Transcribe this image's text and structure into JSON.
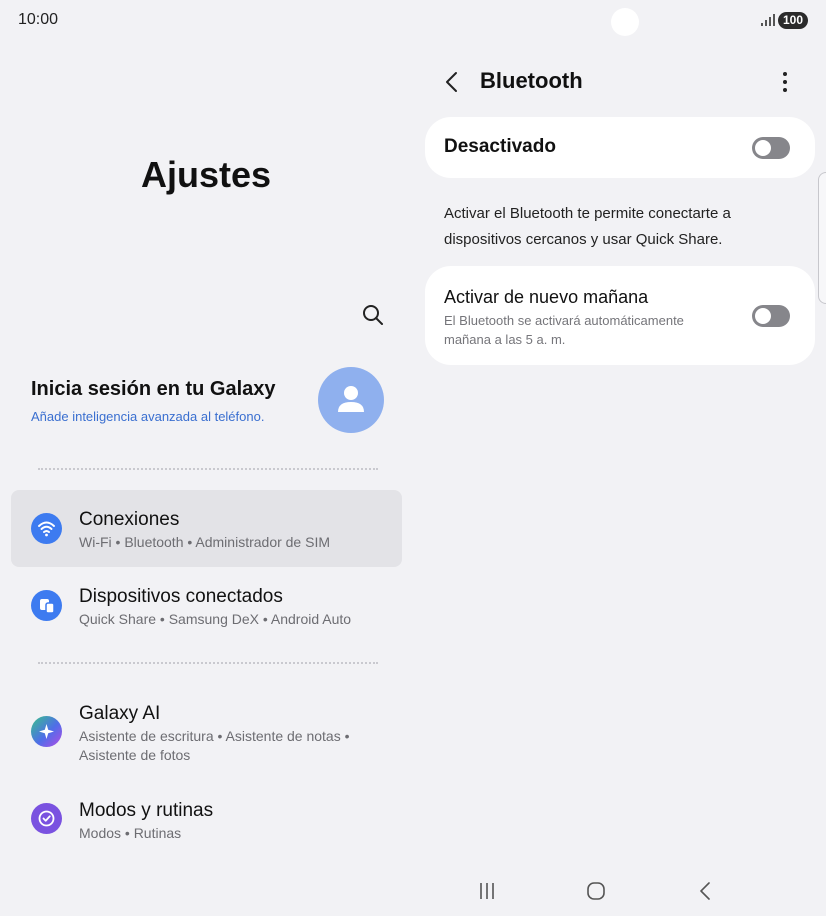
{
  "status_bar": {
    "time": "10:00",
    "battery": "100"
  },
  "settings": {
    "title": "Ajustes",
    "account": {
      "title": "Inicia sesión en tu Galaxy",
      "subtitle": "Añade inteligencia avanzada al teléfono."
    },
    "items": [
      {
        "title": "Conexiones",
        "subtitle": "Wi-Fi  •  Bluetooth  •  Administrador de SIM",
        "icon": "wifi-icon",
        "color": "#3d7bf0"
      },
      {
        "title": "Dispositivos conectados",
        "subtitle": "Quick Share  •  Samsung DeX  •  Android Auto",
        "icon": "devices-icon",
        "color": "#3d7bf0"
      },
      {
        "title": "Galaxy AI",
        "subtitle": "Asistente de escritura  •  Asistente de notas  •  Asistente de fotos",
        "icon": "sparkle-icon",
        "color": "#4f6ee8"
      },
      {
        "title": "Modos y rutinas",
        "subtitle": "Modos  •  Rutinas",
        "icon": "routine-icon",
        "color": "#7a52e0"
      }
    ]
  },
  "bluetooth": {
    "title": "Bluetooth",
    "main_toggle_label": "Desactivado",
    "main_toggle_on": false,
    "description": "Activar el Bluetooth te permite conectarte a dispositivos cercanos y usar Quick Share.",
    "reactivate": {
      "title": "Activar de nuevo mañana",
      "subtitle": "El Bluetooth se activará automáticamente mañana a las 5 a. m.",
      "on": false
    }
  },
  "colors": {
    "accent_blue": "#3a6fd0",
    "toggle_off": "#86868b",
    "background": "#f2f2f5"
  }
}
